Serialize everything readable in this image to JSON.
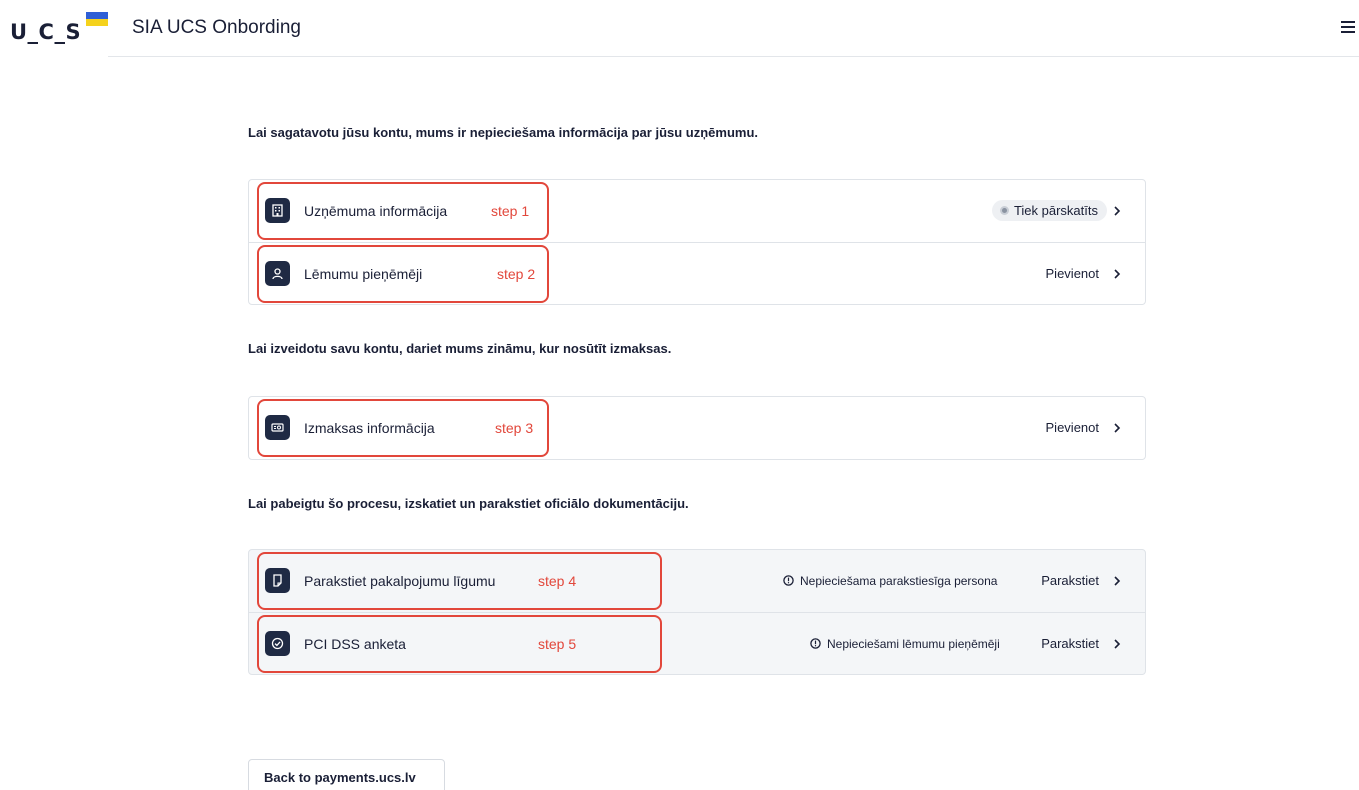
{
  "header": {
    "logo_text": "U_C_S",
    "title": "SIA UCS Onbording",
    "menu_icon": "hamburger-menu-icon"
  },
  "sections": [
    {
      "heading": "Lai sagatavotu jūsu kontu, mums ir nepieciešama informācija par jūsu uzņēmumu.",
      "rows": [
        {
          "icon": "building-icon",
          "label": "Uzņēmuma informācija",
          "step": "step 1",
          "status": "Tiek pārskatīts"
        },
        {
          "icon": "person-icon",
          "label": "Lēmumu pieņēmēji",
          "step": "step 2",
          "action": "Pievienot"
        }
      ]
    },
    {
      "heading": "Lai izveidotu savu kontu, dariet mums zināmu, kur nosūtīt izmaksas.",
      "rows": [
        {
          "icon": "payout-icon",
          "label": "Izmaksas informācija",
          "step": "step 3",
          "action": "Pievienot"
        }
      ]
    },
    {
      "heading": "Lai pabeigtu šo procesu, izskatiet un parakstiet oficiālo dokumentāciju.",
      "rows": [
        {
          "icon": "document-icon",
          "label": "Parakstiet pakalpojumu līgumu",
          "step": "step 4",
          "warning": "Nepieciešama parakstiesīga persona",
          "action": "Parakstiet"
        },
        {
          "icon": "check-circle-icon",
          "label": "PCI DSS anketa",
          "step": "step 5",
          "warning": "Nepieciešami lēmumu pieņēmēji",
          "action": "Parakstiet"
        }
      ]
    }
  ],
  "footer": {
    "back_label": "Back to payments.ucs.lv"
  },
  "colors": {
    "dark": "#1f2a44",
    "annotation": "#e2473b",
    "border": "#dfe3e8",
    "gray_card": "#f4f6f8"
  }
}
